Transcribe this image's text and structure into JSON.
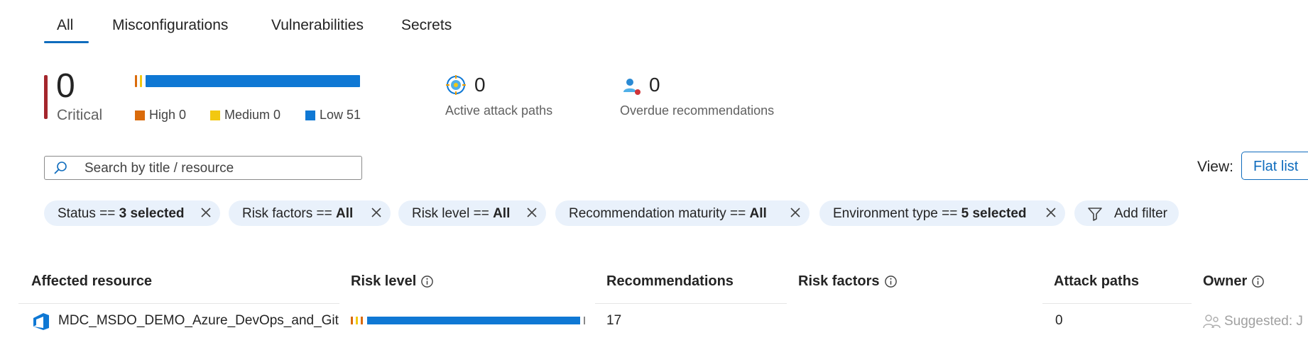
{
  "tabs": [
    {
      "label": "All",
      "active": true
    },
    {
      "label": "Misconfigurations"
    },
    {
      "label": "Vulnerabilities"
    },
    {
      "label": "Secrets"
    }
  ],
  "summary": {
    "critical": {
      "count": "0",
      "label": "Critical",
      "color": "#a4262c"
    },
    "risk_bar": {
      "high": 0,
      "medium": 0,
      "low": 51
    },
    "legend": [
      {
        "label": "High 0",
        "color": "#da6b0b"
      },
      {
        "label": "Medium 0",
        "color": "#f2c811"
      },
      {
        "label": "Low 51",
        "color": "#0f78d4"
      }
    ],
    "attack_paths": {
      "count": "0",
      "label": "Active attack paths",
      "icon": "target-icon"
    },
    "overdue": {
      "count": "0",
      "label": "Overdue recommendations",
      "icon": "overdue-user-icon"
    }
  },
  "search": {
    "placeholder": "Search by title / resource",
    "value": ""
  },
  "view": {
    "label": "View:",
    "button": "Flat list"
  },
  "filters": [
    {
      "key": "Status",
      "op": "==",
      "value": "3 selected"
    },
    {
      "key": "Risk factors",
      "op": "==",
      "value": "All"
    },
    {
      "key": "Risk level",
      "op": "==",
      "value": "All"
    },
    {
      "key": "Recommendation maturity",
      "op": "==",
      "value": "All"
    },
    {
      "key": "Environment type",
      "op": "==",
      "value": "5 selected"
    }
  ],
  "add_filter": "Add filter",
  "table": {
    "columns": [
      "Affected resource",
      "Risk level",
      "Recommendations",
      "Risk factors",
      "Attack paths",
      "Owner"
    ],
    "rows": [
      {
        "resource": "MDC_MSDO_DEMO_Azure_DevOps_and_Git",
        "recommendations": "17",
        "risk_factors": "",
        "attack_paths": "0",
        "owner": "Suggested: J"
      }
    ]
  },
  "colors": {
    "accent": "#0f6cbd",
    "chip_bg": "#e9f1fb",
    "low": "#0f78d4",
    "high": "#da6b0b",
    "medium": "#f2c811"
  }
}
